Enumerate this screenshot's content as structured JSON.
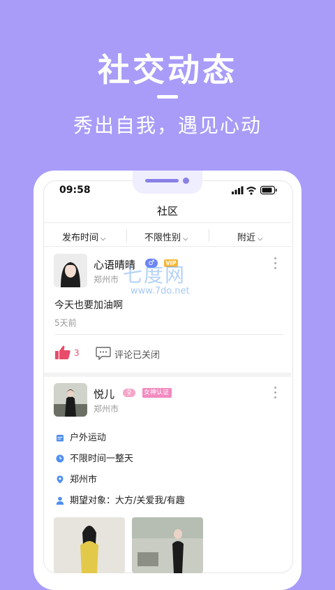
{
  "hero": {
    "title": "社交动态",
    "subtitle": "秀出自我，遇见心动"
  },
  "status_bar": {
    "time": "09:58"
  },
  "nav": {
    "title": "社区"
  },
  "filters": [
    {
      "label": "发布时间"
    },
    {
      "label": "不限性别"
    },
    {
      "label": "附近"
    }
  ],
  "watermark": {
    "text": "七度网",
    "url": "www.7do.net"
  },
  "posts": [
    {
      "name": "心语晴晴",
      "city": "郑州市",
      "gender_icon": "male-icon",
      "vip_label": "VIP",
      "text": "今天也要加油啊",
      "time_ago": "5天前",
      "likes": "3",
      "comment_status": "评论已关闭"
    },
    {
      "name": "悦儿",
      "city": "郑州市",
      "badge_label": "女神认证",
      "details": [
        {
          "icon": "calendar-icon",
          "text": "户外运动"
        },
        {
          "icon": "clock-icon",
          "text": "不限时间一整天"
        },
        {
          "icon": "location-icon",
          "text": "郑州市"
        },
        {
          "icon": "person-icon",
          "text": "期望对象：大方/关爱我/有趣"
        }
      ]
    }
  ],
  "colors": {
    "background": "#a89cf8",
    "accent": "#6d84f5",
    "like_red": "#e94b6a",
    "goddess_pink": "#f28ac0",
    "detail_icon_blue": "#4f8ff0"
  }
}
